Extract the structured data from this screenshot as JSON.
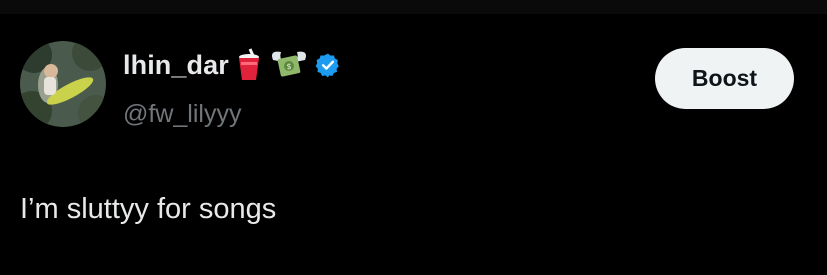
{
  "post": {
    "author": {
      "display_name": "lhin_dar",
      "handle": "@fw_lilyyy",
      "name_emojis": [
        "cup-with-straw-icon",
        "money-with-wings-icon"
      ],
      "verified": true
    },
    "follow_button": {
      "label": "Boost"
    },
    "text": "I’m sluttyy for songs"
  },
  "colors": {
    "background": "#000000",
    "primary_text": "#e7e9ea",
    "secondary_text": "#71767b",
    "verified_blue": "#1d9bf0",
    "button_bg": "#eff3f4",
    "button_text": "#0f1419"
  }
}
